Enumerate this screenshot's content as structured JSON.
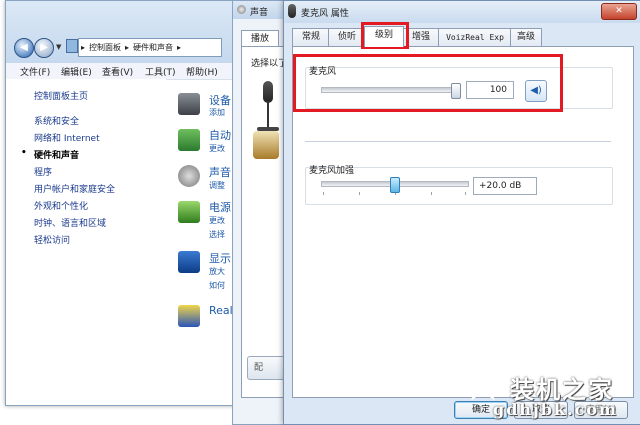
{
  "control_panel": {
    "breadcrumb": [
      "控制面板",
      "硬件和声音"
    ],
    "menu": [
      "文件(F)",
      "编辑(E)",
      "查看(V)",
      "工具(T)",
      "帮助(H)"
    ],
    "nav": [
      "控制面板主页",
      "系统和安全",
      "网络和 Internet",
      "硬件和声音",
      "程序",
      "用户帐户和家庭安全",
      "外观和个性化",
      "时钟、语言和区域",
      "轻松访问"
    ],
    "categories": [
      {
        "title": "设备",
        "sub": [
          "添加"
        ]
      },
      {
        "title": "自动",
        "sub": [
          "更改"
        ]
      },
      {
        "title": "声音",
        "sub": [
          "调整"
        ]
      },
      {
        "title": "电源",
        "sub": [
          "更改",
          "选择"
        ]
      },
      {
        "title": "显示",
        "sub": [
          "放大",
          "如何"
        ]
      },
      {
        "title": "Real",
        "sub": []
      }
    ]
  },
  "sound_dialog": {
    "title": "声音",
    "tab": "播放",
    "prompt": "选择以了",
    "bottom_btn": "配"
  },
  "mic_dialog": {
    "title": "麦克风 属性",
    "tabs": [
      "常规",
      "侦听",
      "级别",
      "增强",
      "VoizReal Exp",
      "高级"
    ],
    "active_tab": "级别",
    "mic_label": "麦克风",
    "mic_value": "100",
    "mic_level": 1.0,
    "boost_label": "麦克风加强",
    "boost_value": "+20.0 dB",
    "boost_level": 0.5,
    "ok": "确定",
    "cancel": "取消",
    "apply": "应用(A)"
  },
  "watermark": {
    "cn": "装机之家",
    "url": "gdhjbk.com"
  },
  "colors": {
    "highlight": "#e31a22",
    "link": "#1a3a8c"
  }
}
